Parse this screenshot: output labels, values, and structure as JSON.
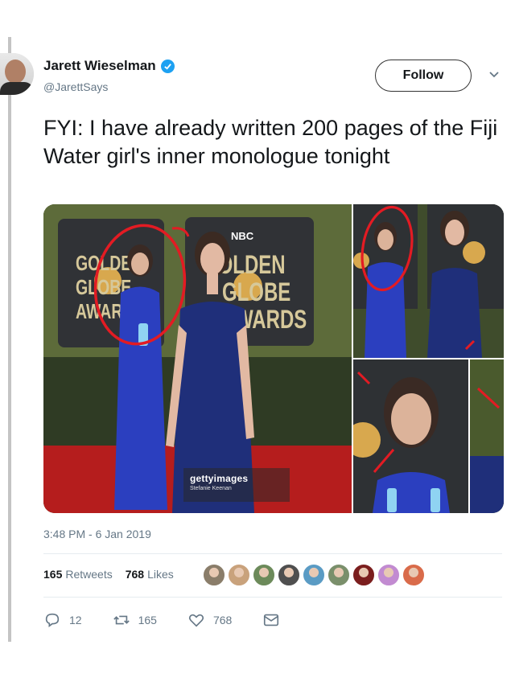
{
  "author": {
    "display_name": "Jarett Wieselman",
    "handle": "@JarettSays",
    "verified": true
  },
  "follow_button": {
    "label": "Follow"
  },
  "tweet": {
    "text": "FYI: I have already written 200 pages of the Fiji Water girl's inner monologue tonight",
    "timestamp": "3:48 PM - 6 Jan 2019"
  },
  "media": {
    "backdrop_text": {
      "network": "NBC",
      "main_left": [
        "GOLDEN",
        "GLOBE",
        "AWARDS"
      ],
      "main_right": [
        "GOLDEN",
        "GLOBE",
        "AWARDS"
      ]
    },
    "watermark": {
      "logo": "gettyimages",
      "credit": "Stefanie Keenan"
    },
    "annotation_color": "#e31b23"
  },
  "stats": {
    "retweets_count": "165",
    "retweets_label": "Retweets",
    "likes_count": "768",
    "likes_label": "Likes",
    "liker_avatar_colors": [
      "#8a7d6a",
      "#c9a27c",
      "#6c8a5a",
      "#4f4f4f",
      "#5a9bc4",
      "#7a8f6b",
      "#7b1e1e",
      "#c28bd1",
      "#d96b4a"
    ]
  },
  "actions": {
    "reply_count": "12",
    "retweet_count": "165",
    "like_count": "768"
  },
  "colors": {
    "text": "#14171a",
    "secondary": "#657786",
    "verified": "#1da1f2",
    "divider": "#e6ecf0"
  }
}
